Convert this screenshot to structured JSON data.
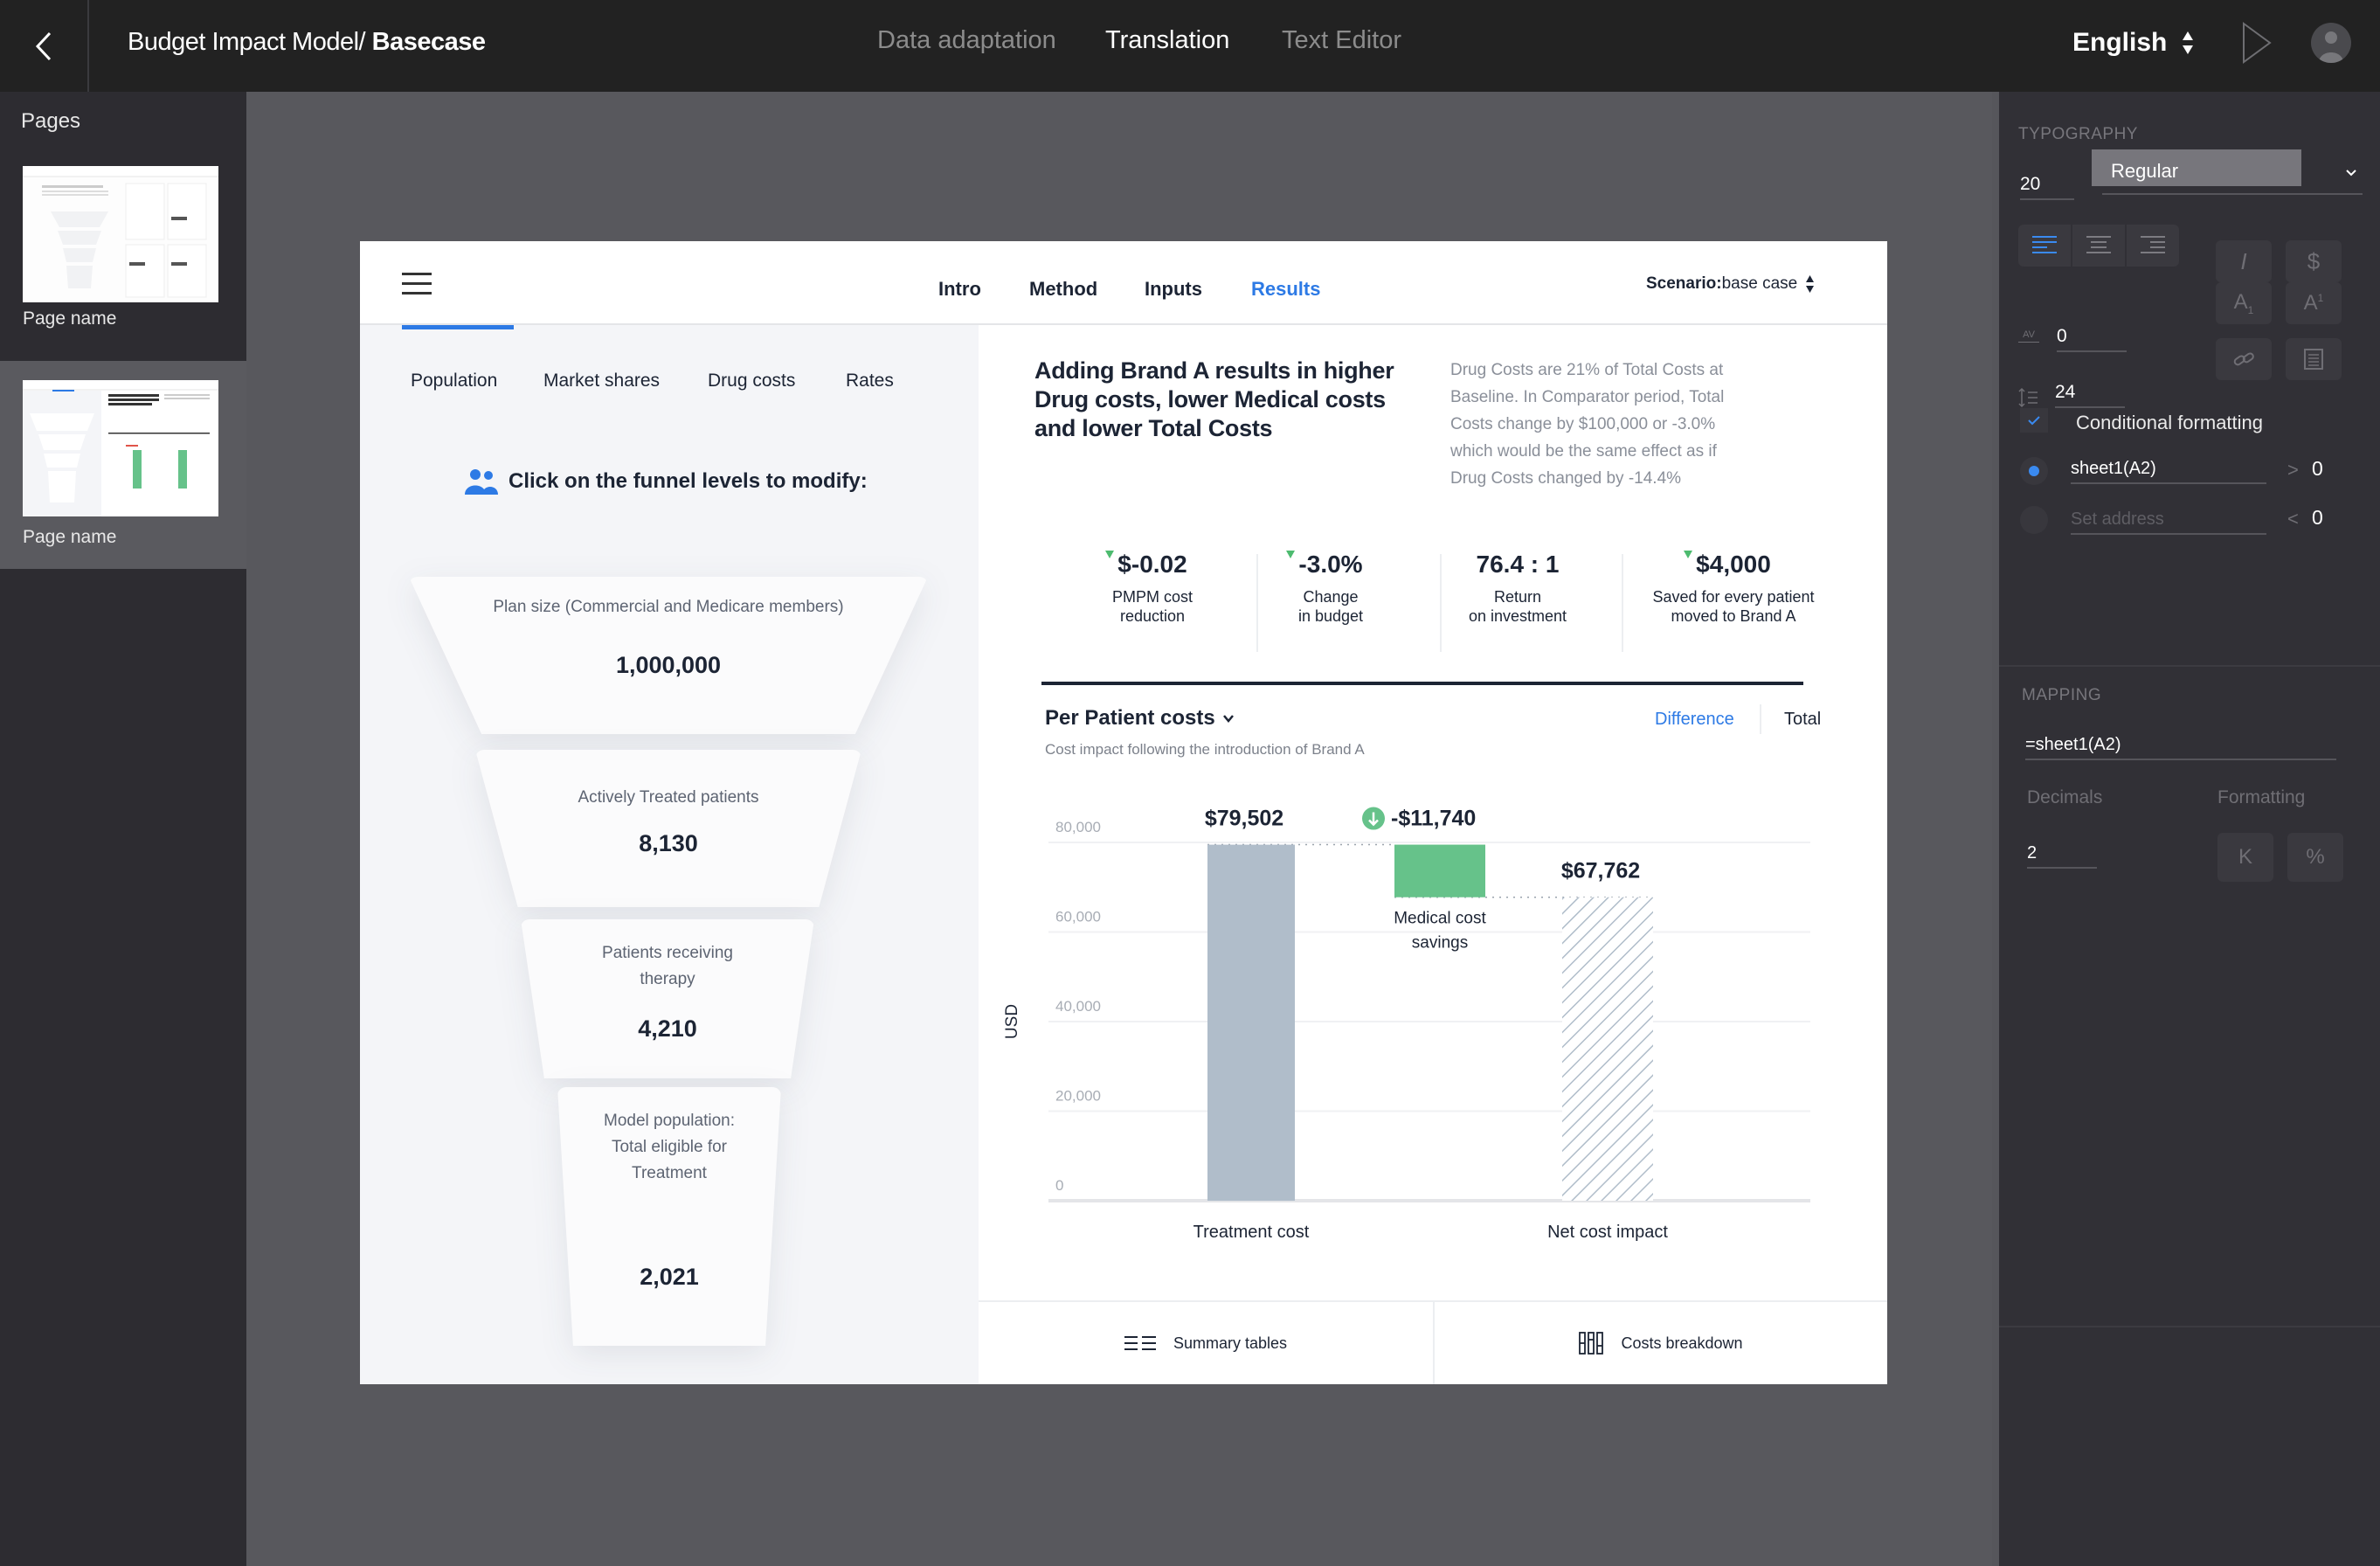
{
  "topbar": {
    "back_icon": "chevron-left-icon",
    "title_prefix": "Budget Impact Model/ ",
    "title_bold": "Basecase",
    "tabs": [
      {
        "label": "Data adaptation",
        "active": false
      },
      {
        "label": "Translation",
        "active": true
      },
      {
        "label": "Text Editor",
        "active": false
      }
    ],
    "language": "English",
    "play_icon": "play-icon",
    "avatar_icon": "user-avatar-icon"
  },
  "sidebar": {
    "title": "Pages",
    "pages": [
      {
        "name": "Page name",
        "selected": false
      },
      {
        "name": "Page name",
        "selected": true
      }
    ]
  },
  "right_panel": {
    "typography": {
      "label": "TYPOGRAPHY",
      "font_size": "20",
      "font_weight": "Regular",
      "alignment_options": [
        "align-left",
        "align-center",
        "align-right"
      ],
      "alignment_selected": "align-left",
      "letter_spacing": "0",
      "line_height": "24",
      "style_buttons": [
        "italic",
        "currency",
        "subscript",
        "superscript",
        "link",
        "paragraph"
      ],
      "italic_glyph": "I",
      "currency_glyph": "$",
      "subscript_glyph": "A",
      "subscript_sub": "1",
      "superscript_glyph": "A",
      "superscript_sup": "1",
      "letter_spacing_icon_text": "AV"
    },
    "conditional_formatting": {
      "checked": true,
      "label": "Conditional formatting",
      "rules": [
        {
          "address": "sheet1(A2)",
          "placeholder": "Set address",
          "operator": ">",
          "value": "0",
          "active": true
        },
        {
          "address": "",
          "placeholder": "Set address",
          "operator": "<",
          "value": "0",
          "active": false
        }
      ]
    },
    "mapping": {
      "label": "MAPPING",
      "formula": "=sheet1(A2)",
      "decimals_label": "Decimals",
      "decimals": "2",
      "formatting_label": "Formatting",
      "formatting_options": [
        "K",
        "%"
      ]
    }
  },
  "artboard": {
    "nav": [
      {
        "label": "Intro",
        "active": false
      },
      {
        "label": "Method",
        "active": false
      },
      {
        "label": "Inputs",
        "active": false
      },
      {
        "label": "Results",
        "active": true
      }
    ],
    "scenario_label": "Scenario:",
    "scenario_value": "base case",
    "sub_tabs": [
      {
        "label": "Population",
        "active": true
      },
      {
        "label": "Market shares",
        "active": false
      },
      {
        "label": "Drug costs",
        "active": false
      },
      {
        "label": "Rates",
        "active": false
      }
    ],
    "funnel_hint": "Click on the funnel levels to modify:",
    "funnel": [
      {
        "label": "Plan size (Commercial and Medicare members)",
        "value": "1,000,000"
      },
      {
        "label": "Actively Treated patients",
        "value": "8,130"
      },
      {
        "label": "Patients receiving therapy",
        "value": "4,210"
      },
      {
        "label": "Model population: Total eligible for Treatment",
        "value": "2,021"
      }
    ],
    "headline": "Adding Brand A results in higher Drug costs, lower Medical costs and lower Total Costs",
    "summary": "Drug Costs are 21% of Total Costs at Baseline. In Comparator period, Total Costs change by $100,000 or -3.0% which would be the same effect as if Drug Costs changed by -14.4%",
    "kpis": [
      {
        "value": "$-0.02",
        "label_line1": "PMPM cost",
        "label_line2": "reduction",
        "trend": "down"
      },
      {
        "value": "-3.0%",
        "label_line1": "Change",
        "label_line2": "in budget",
        "trend": "down"
      },
      {
        "value": "76.4 : 1",
        "label_line1": "Return",
        "label_line2": "on investment",
        "trend": "none"
      },
      {
        "value": "$4,000",
        "label_line1": "Saved for every patient",
        "label_line2": "moved to Brand A",
        "trend": "down"
      }
    ],
    "chart_title": "Per Patient costs",
    "chart_subtitle": "Cost impact following the introduction of Brand A",
    "view_toggle": {
      "difference": "Difference",
      "total": "Total",
      "selected": "Difference"
    },
    "bottom_buttons": [
      {
        "label": "Summary tables",
        "icon": "list-icon"
      },
      {
        "label": "Costs breakdown",
        "icon": "columns-icon"
      }
    ],
    "colors": {
      "accent": "#2d7ae5",
      "positive": "#66c28a",
      "neutral_bar": "#b0bdca",
      "text": "#1c2434"
    }
  },
  "chart_data": {
    "type": "bar",
    "subtype": "waterfall",
    "title": "Per Patient costs",
    "subtitle": "Cost impact following the introduction of Brand A",
    "ylabel": "USD",
    "xlabel": "",
    "ylim": [
      0,
      80000
    ],
    "yticks": [
      0,
      20000,
      40000,
      60000,
      80000
    ],
    "ytick_labels": [
      "0",
      "20,000",
      "40,000",
      "60,000",
      "80,000"
    ],
    "grid": true,
    "categories": [
      "Treatment cost",
      "Medical cost savings",
      "Net cost impact"
    ],
    "values": [
      79502,
      -11740,
      67762
    ],
    "value_labels": [
      "$79,502",
      "-$11,740",
      "$67,762"
    ],
    "bar_styles": [
      "solid-gray",
      "solid-green",
      "hatched-gray"
    ],
    "category_label_positions": [
      "below-axis",
      "below-bar",
      "below-axis"
    ]
  }
}
